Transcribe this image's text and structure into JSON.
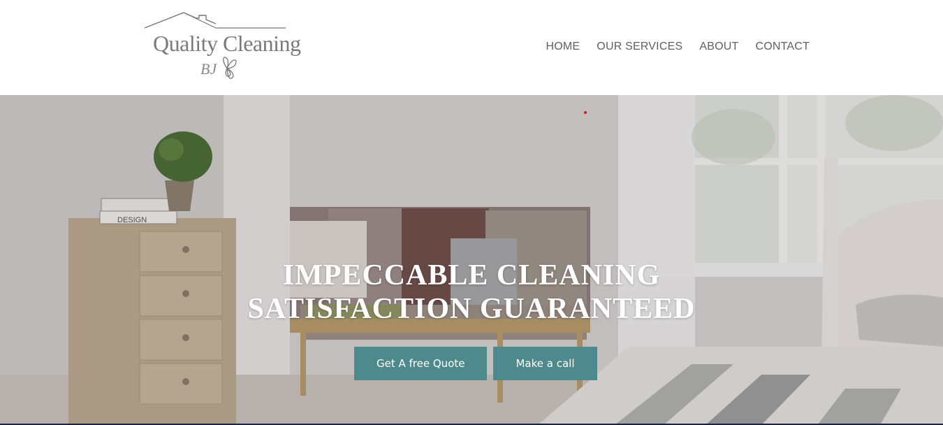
{
  "brand": {
    "logo_line1": "Quality Cleaning",
    "logo_line2": "BJ",
    "logo_icon": "house-roof-and-butterfly"
  },
  "nav": {
    "items": [
      {
        "label": "HOME"
      },
      {
        "label": "OUR SERVICES"
      },
      {
        "label": "ABOUT"
      },
      {
        "label": "CONTACT"
      }
    ]
  },
  "hero": {
    "line1": "IMPECCABLE CLEANING",
    "line2": "SATISFACTION GUARANTEED",
    "primary_cta": "Get A free Quote",
    "secondary_cta": "Make a call",
    "book_label": "DESIGN",
    "cta_color": "#4e8a8c"
  }
}
